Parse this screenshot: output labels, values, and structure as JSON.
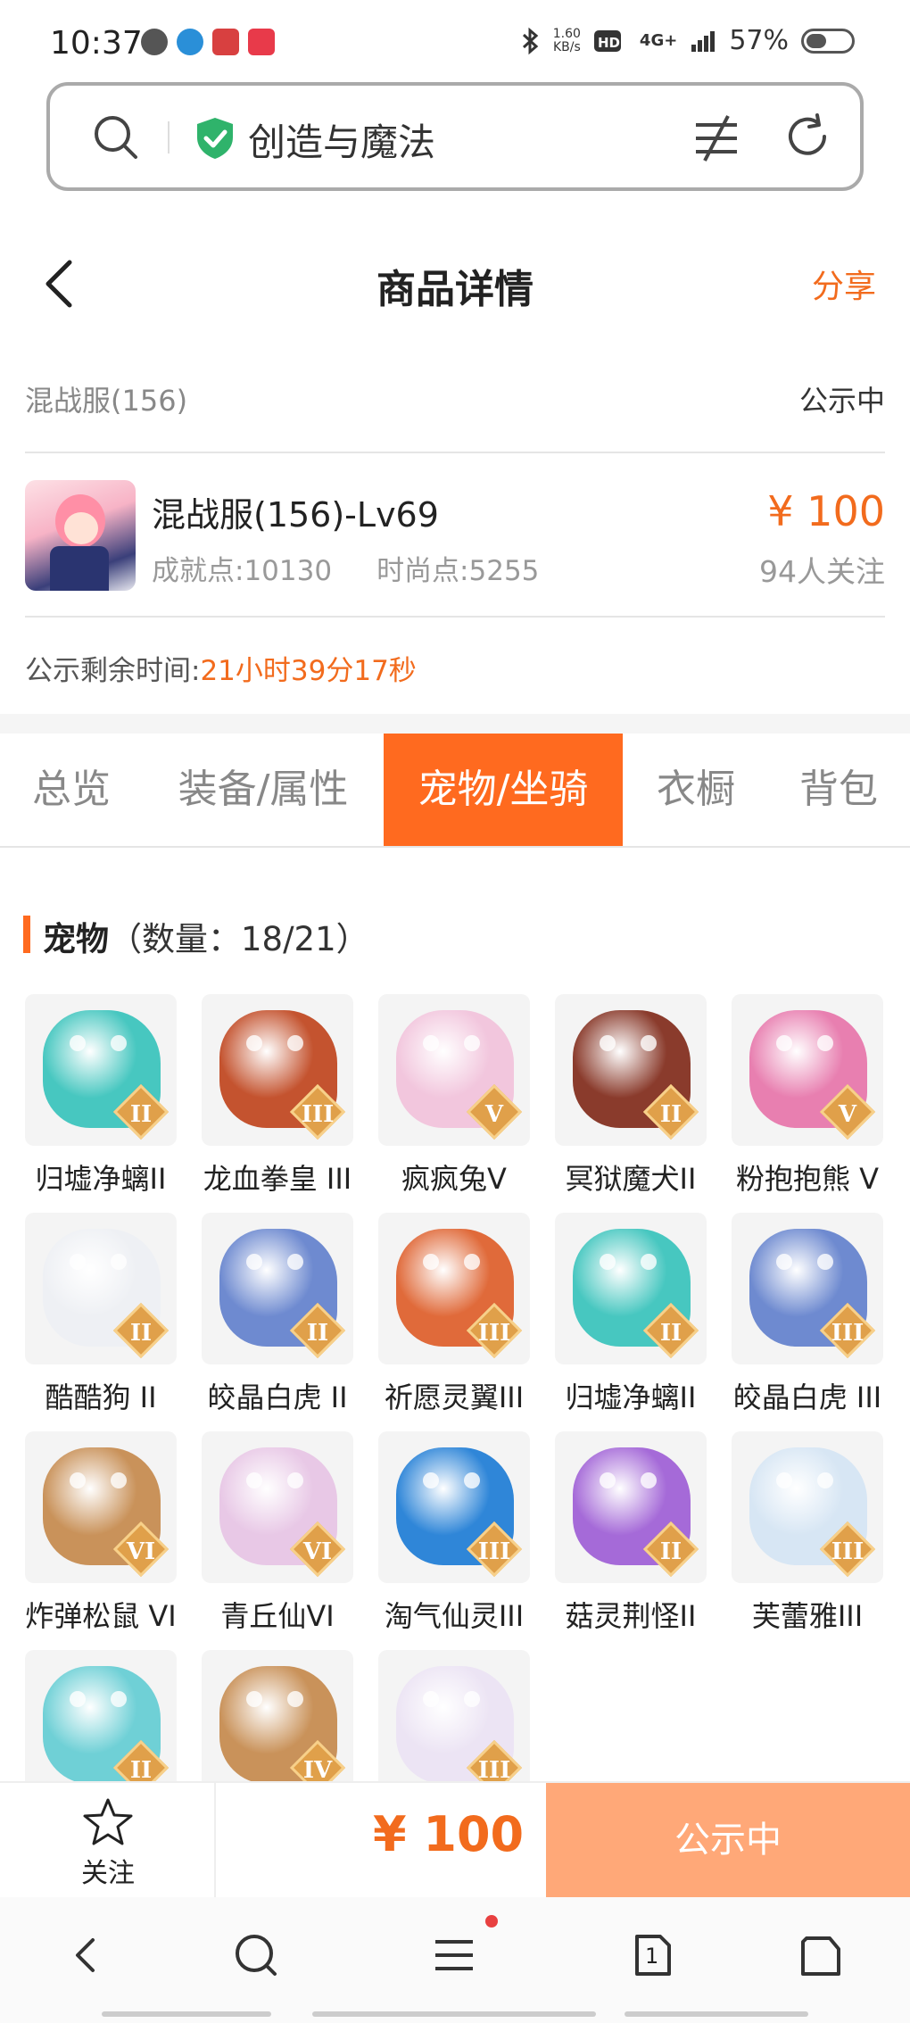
{
  "status_bar": {
    "time": "10:37",
    "net_speed_value": "1.60",
    "net_speed_unit": "KB/s",
    "network": "4G+",
    "battery": "57%",
    "icons": [
      "bluetooth-icon",
      "hd-icon",
      "signal-icon",
      "battery-icon"
    ]
  },
  "browser": {
    "url_text": "创造与魔法",
    "icons": [
      "search-icon",
      "shield-check-icon",
      "filter-icon",
      "refresh-icon"
    ],
    "tab_count": "1"
  },
  "header": {
    "title": "商品详情",
    "share": "分享"
  },
  "server": {
    "name": "混战服(156)",
    "status": "公示中"
  },
  "product": {
    "title": "混战服(156)-Lv69",
    "achievement": "成就点:10130",
    "fashion": "时尚点:5255",
    "price": "¥ 100",
    "followers": "94人关注"
  },
  "remaining": {
    "label": "公示剩余时间:",
    "value": "21小时39分17秒"
  },
  "tabs": [
    "总览",
    "装备/属性",
    "宠物/坐骑",
    "衣橱",
    "背包"
  ],
  "active_tab": "宠物/坐骑",
  "pets_section": {
    "title": "宠物",
    "count": "（数量：18/21）",
    "pets": [
      {
        "name": "归墟净螭II",
        "level": "II",
        "color": "#47c7c0"
      },
      {
        "name": "龙血拳皇 III",
        "level": "III",
        "color": "#c4532f"
      },
      {
        "name": "疯疯兔V",
        "level": "V",
        "color": "#f2c6dd"
      },
      {
        "name": "冥狱魔犬II",
        "level": "II",
        "color": "#8a3b2c"
      },
      {
        "name": "粉抱抱熊 V",
        "level": "V",
        "color": "#e87fb0"
      },
      {
        "name": "酷酷狗 II",
        "level": "II",
        "color": "#eef0f4"
      },
      {
        "name": "皎晶白虎 II",
        "level": "II",
        "color": "#6e8ad0"
      },
      {
        "name": "祈愿灵翼III",
        "level": "III",
        "color": "#e06a3a"
      },
      {
        "name": "归墟净螭II",
        "level": "II",
        "color": "#47c7c0"
      },
      {
        "name": "皎晶白虎 III",
        "level": "III",
        "color": "#6e8ad0"
      },
      {
        "name": "炸弹松鼠 VI",
        "level": "VI",
        "color": "#c9925a"
      },
      {
        "name": "青丘仙VI",
        "level": "VI",
        "color": "#e8c8e6"
      },
      {
        "name": "淘气仙灵III",
        "level": "III",
        "color": "#2f86d8"
      },
      {
        "name": "菇灵荆怪II",
        "level": "II",
        "color": "#a56ad8"
      },
      {
        "name": "芙蕾雅III",
        "level": "III",
        "color": "#d7e6f4"
      },
      {
        "name": "",
        "level": "II",
        "color": "#6fd0d6"
      },
      {
        "name": "",
        "level": "IV",
        "color": "#c9925a"
      },
      {
        "name": "",
        "level": "III",
        "color": "#ece4f4"
      }
    ]
  },
  "bottom_bar": {
    "follow_label": "关注",
    "price": "¥ 100",
    "status_button": "公示中"
  },
  "colors": {
    "accent": "#ff6a1f",
    "price": "#f26b1d",
    "status_button": "#ffa878",
    "secure_shield": "#2fb36b"
  }
}
